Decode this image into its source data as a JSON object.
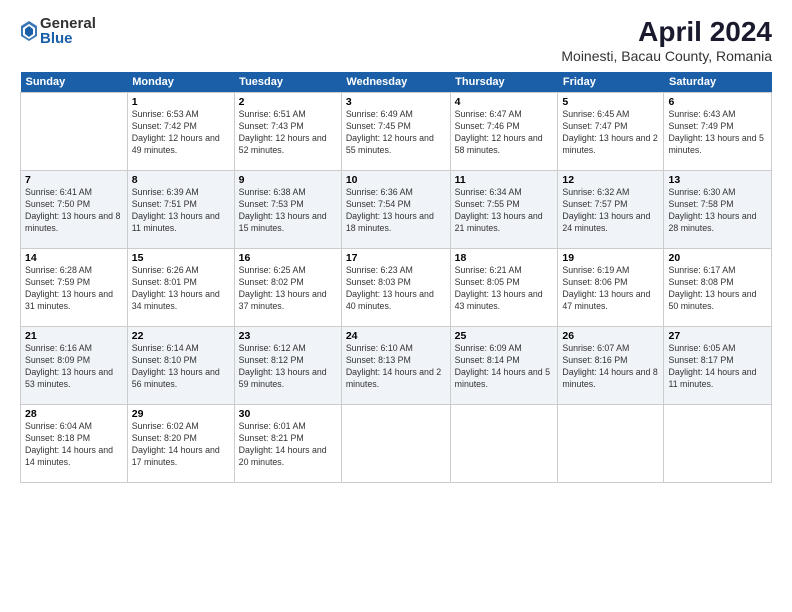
{
  "header": {
    "logo_general": "General",
    "logo_blue": "Blue",
    "title": "April 2024",
    "location": "Moinesti, Bacau County, Romania"
  },
  "days_of_week": [
    "Sunday",
    "Monday",
    "Tuesday",
    "Wednesday",
    "Thursday",
    "Friday",
    "Saturday"
  ],
  "weeks": [
    [
      {
        "day": "",
        "sunrise": "",
        "sunset": "",
        "daylight": ""
      },
      {
        "day": "1",
        "sunrise": "Sunrise: 6:53 AM",
        "sunset": "Sunset: 7:42 PM",
        "daylight": "Daylight: 12 hours and 49 minutes."
      },
      {
        "day": "2",
        "sunrise": "Sunrise: 6:51 AM",
        "sunset": "Sunset: 7:43 PM",
        "daylight": "Daylight: 12 hours and 52 minutes."
      },
      {
        "day": "3",
        "sunrise": "Sunrise: 6:49 AM",
        "sunset": "Sunset: 7:45 PM",
        "daylight": "Daylight: 12 hours and 55 minutes."
      },
      {
        "day": "4",
        "sunrise": "Sunrise: 6:47 AM",
        "sunset": "Sunset: 7:46 PM",
        "daylight": "Daylight: 12 hours and 58 minutes."
      },
      {
        "day": "5",
        "sunrise": "Sunrise: 6:45 AM",
        "sunset": "Sunset: 7:47 PM",
        "daylight": "Daylight: 13 hours and 2 minutes."
      },
      {
        "day": "6",
        "sunrise": "Sunrise: 6:43 AM",
        "sunset": "Sunset: 7:49 PM",
        "daylight": "Daylight: 13 hours and 5 minutes."
      }
    ],
    [
      {
        "day": "7",
        "sunrise": "Sunrise: 6:41 AM",
        "sunset": "Sunset: 7:50 PM",
        "daylight": "Daylight: 13 hours and 8 minutes."
      },
      {
        "day": "8",
        "sunrise": "Sunrise: 6:39 AM",
        "sunset": "Sunset: 7:51 PM",
        "daylight": "Daylight: 13 hours and 11 minutes."
      },
      {
        "day": "9",
        "sunrise": "Sunrise: 6:38 AM",
        "sunset": "Sunset: 7:53 PM",
        "daylight": "Daylight: 13 hours and 15 minutes."
      },
      {
        "day": "10",
        "sunrise": "Sunrise: 6:36 AM",
        "sunset": "Sunset: 7:54 PM",
        "daylight": "Daylight: 13 hours and 18 minutes."
      },
      {
        "day": "11",
        "sunrise": "Sunrise: 6:34 AM",
        "sunset": "Sunset: 7:55 PM",
        "daylight": "Daylight: 13 hours and 21 minutes."
      },
      {
        "day": "12",
        "sunrise": "Sunrise: 6:32 AM",
        "sunset": "Sunset: 7:57 PM",
        "daylight": "Daylight: 13 hours and 24 minutes."
      },
      {
        "day": "13",
        "sunrise": "Sunrise: 6:30 AM",
        "sunset": "Sunset: 7:58 PM",
        "daylight": "Daylight: 13 hours and 28 minutes."
      }
    ],
    [
      {
        "day": "14",
        "sunrise": "Sunrise: 6:28 AM",
        "sunset": "Sunset: 7:59 PM",
        "daylight": "Daylight: 13 hours and 31 minutes."
      },
      {
        "day": "15",
        "sunrise": "Sunrise: 6:26 AM",
        "sunset": "Sunset: 8:01 PM",
        "daylight": "Daylight: 13 hours and 34 minutes."
      },
      {
        "day": "16",
        "sunrise": "Sunrise: 6:25 AM",
        "sunset": "Sunset: 8:02 PM",
        "daylight": "Daylight: 13 hours and 37 minutes."
      },
      {
        "day": "17",
        "sunrise": "Sunrise: 6:23 AM",
        "sunset": "Sunset: 8:03 PM",
        "daylight": "Daylight: 13 hours and 40 minutes."
      },
      {
        "day": "18",
        "sunrise": "Sunrise: 6:21 AM",
        "sunset": "Sunset: 8:05 PM",
        "daylight": "Daylight: 13 hours and 43 minutes."
      },
      {
        "day": "19",
        "sunrise": "Sunrise: 6:19 AM",
        "sunset": "Sunset: 8:06 PM",
        "daylight": "Daylight: 13 hours and 47 minutes."
      },
      {
        "day": "20",
        "sunrise": "Sunrise: 6:17 AM",
        "sunset": "Sunset: 8:08 PM",
        "daylight": "Daylight: 13 hours and 50 minutes."
      }
    ],
    [
      {
        "day": "21",
        "sunrise": "Sunrise: 6:16 AM",
        "sunset": "Sunset: 8:09 PM",
        "daylight": "Daylight: 13 hours and 53 minutes."
      },
      {
        "day": "22",
        "sunrise": "Sunrise: 6:14 AM",
        "sunset": "Sunset: 8:10 PM",
        "daylight": "Daylight: 13 hours and 56 minutes."
      },
      {
        "day": "23",
        "sunrise": "Sunrise: 6:12 AM",
        "sunset": "Sunset: 8:12 PM",
        "daylight": "Daylight: 13 hours and 59 minutes."
      },
      {
        "day": "24",
        "sunrise": "Sunrise: 6:10 AM",
        "sunset": "Sunset: 8:13 PM",
        "daylight": "Daylight: 14 hours and 2 minutes."
      },
      {
        "day": "25",
        "sunrise": "Sunrise: 6:09 AM",
        "sunset": "Sunset: 8:14 PM",
        "daylight": "Daylight: 14 hours and 5 minutes."
      },
      {
        "day": "26",
        "sunrise": "Sunrise: 6:07 AM",
        "sunset": "Sunset: 8:16 PM",
        "daylight": "Daylight: 14 hours and 8 minutes."
      },
      {
        "day": "27",
        "sunrise": "Sunrise: 6:05 AM",
        "sunset": "Sunset: 8:17 PM",
        "daylight": "Daylight: 14 hours and 11 minutes."
      }
    ],
    [
      {
        "day": "28",
        "sunrise": "Sunrise: 6:04 AM",
        "sunset": "Sunset: 8:18 PM",
        "daylight": "Daylight: 14 hours and 14 minutes."
      },
      {
        "day": "29",
        "sunrise": "Sunrise: 6:02 AM",
        "sunset": "Sunset: 8:20 PM",
        "daylight": "Daylight: 14 hours and 17 minutes."
      },
      {
        "day": "30",
        "sunrise": "Sunrise: 6:01 AM",
        "sunset": "Sunset: 8:21 PM",
        "daylight": "Daylight: 14 hours and 20 minutes."
      },
      {
        "day": "",
        "sunrise": "",
        "sunset": "",
        "daylight": ""
      },
      {
        "day": "",
        "sunrise": "",
        "sunset": "",
        "daylight": ""
      },
      {
        "day": "",
        "sunrise": "",
        "sunset": "",
        "daylight": ""
      },
      {
        "day": "",
        "sunrise": "",
        "sunset": "",
        "daylight": ""
      }
    ]
  ]
}
